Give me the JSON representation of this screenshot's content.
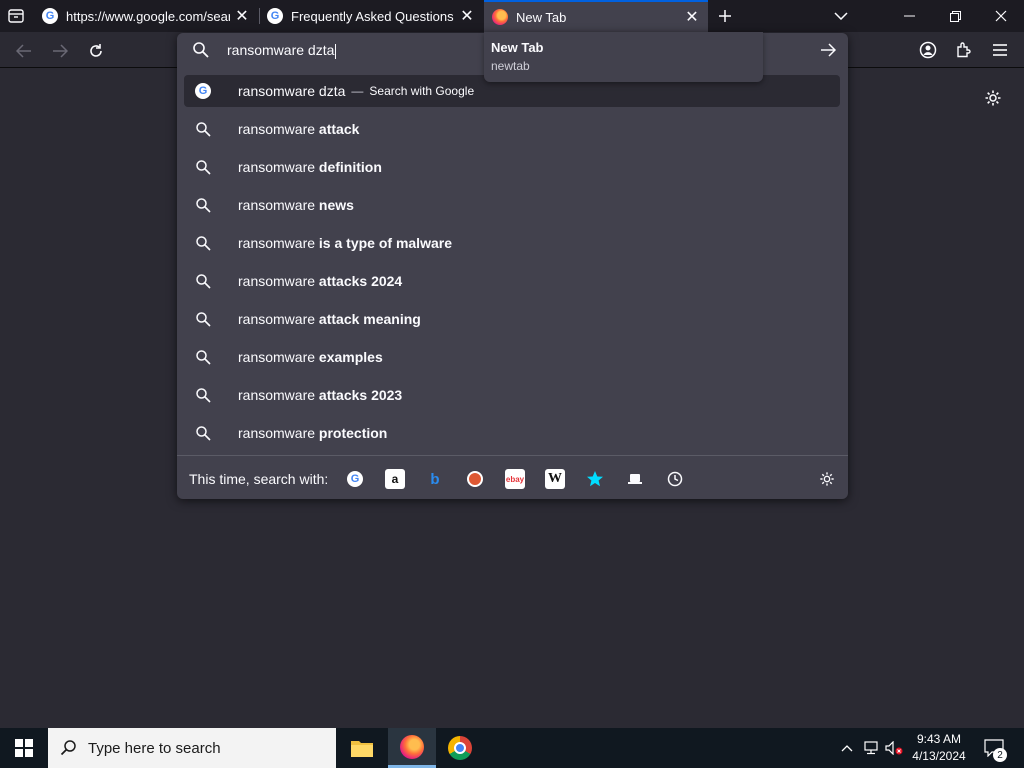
{
  "tabs": [
    {
      "title": "https://www.google.com/search",
      "favicon": "google-icon"
    },
    {
      "title": "Frequently Asked Questions | re",
      "favicon": "google-icon"
    },
    {
      "title": "New Tab",
      "favicon": "firefox-icon",
      "active": true
    }
  ],
  "tooltip": {
    "title": "New Tab",
    "subtitle": "newtab"
  },
  "urlbar": {
    "value": "ransomware dzta"
  },
  "results": [
    {
      "prefix": "ransomware dzta",
      "bold": "",
      "action": "Search with Google",
      "type": "google"
    },
    {
      "prefix": "ransomware ",
      "bold": "attack"
    },
    {
      "prefix": "ransomware ",
      "bold": "definition"
    },
    {
      "prefix": "ransomware ",
      "bold": "news"
    },
    {
      "prefix": "ransomware ",
      "bold": "is a type of malware"
    },
    {
      "prefix": "ransomware ",
      "bold": "attacks 2024"
    },
    {
      "prefix": "ransomware ",
      "bold": "attack meaning"
    },
    {
      "prefix": "ransomware ",
      "bold": "examples"
    },
    {
      "prefix": "ransomware ",
      "bold": "attacks 2023"
    },
    {
      "prefix": "ransomware ",
      "bold": "protection"
    }
  ],
  "oneoff": {
    "label": "This time, search with:",
    "engines": [
      "google-icon",
      "amazon-icon",
      "bing-icon",
      "duckduckgo-icon",
      "ebay-icon",
      "wikipedia-icon",
      "bookmarks-icon",
      "tabs-icon",
      "history-icon"
    ]
  },
  "taskbar": {
    "search_placeholder": "Type here to search",
    "time": "9:43 AM",
    "date": "4/13/2024",
    "notifications": "2"
  },
  "colors": {
    "accent": "#0061e0",
    "panel": "#42414d",
    "background": "#2b2a33",
    "tabstrip": "#1c1b22"
  }
}
